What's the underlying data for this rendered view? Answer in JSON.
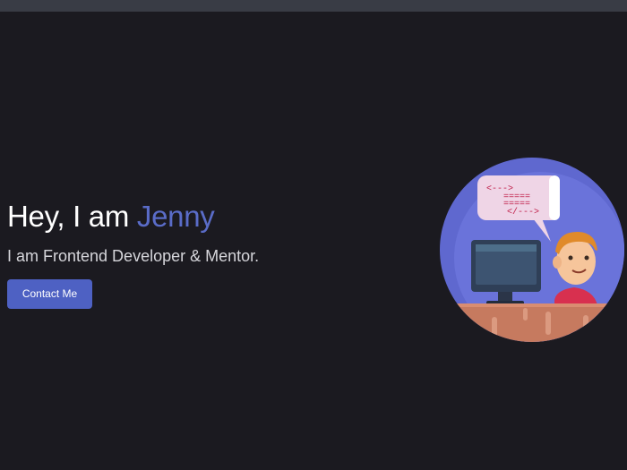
{
  "hero": {
    "title_prefix": "Hey, I am ",
    "title_name": "Jenny",
    "subtitle": "I am Frontend Developer & Mentor.",
    "cta_label": "Contact Me"
  },
  "illustration": {
    "code_lines": [
      "<--->",
      "=====",
      "=====",
      "</--->"
    ]
  },
  "colors": {
    "background": "#1b1a20",
    "accent": "#4e61c3",
    "name_highlight": "#5a6cc8"
  }
}
